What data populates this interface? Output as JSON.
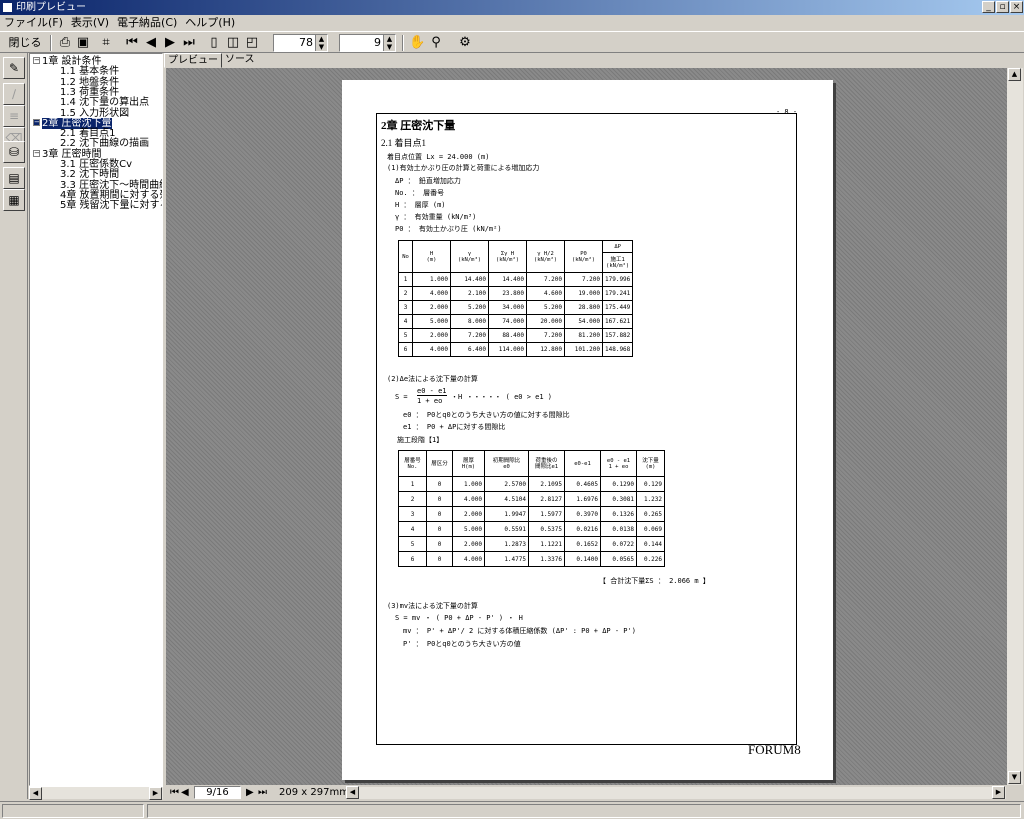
{
  "window": {
    "title": "印刷プレビュー"
  },
  "menu": [
    "ファイル(F)",
    "表示(V)",
    "電子納品(C)",
    "ヘルプ(H)"
  ],
  "toolbar": {
    "close_label": "閉じる",
    "zoom_value": "78",
    "page_value": "9"
  },
  "tree": [
    {
      "label": "1章 設計条件",
      "toggle": "−"
    },
    {
      "label": "1.1 基本条件"
    },
    {
      "label": "1.2 地盤条件"
    },
    {
      "label": "1.3 荷重条件"
    },
    {
      "label": "1.4 沈下量の算出点"
    },
    {
      "label": "1.5 入力形状図"
    },
    {
      "label": "2章 圧密沈下量",
      "toggle": "−",
      "selected": true
    },
    {
      "label": "2.1 着目点1"
    },
    {
      "label": "2.2 沈下曲線の描画"
    },
    {
      "label": "3章 圧密時間",
      "toggle": "−"
    },
    {
      "label": "3.1 圧密係数Cv"
    },
    {
      "label": "3.2 沈下時間"
    },
    {
      "label": "3.3 圧密沈下〜時間曲線"
    },
    {
      "label": "4章 放置期間に対する残留沈"
    },
    {
      "label": "5章 残留沈下量に対する放置"
    }
  ],
  "tabs": [
    "プレビュー",
    "ソース"
  ],
  "document": {
    "page_no": "- 8 -",
    "chapter": "2章 圧密沈下量",
    "section": "2.1 着目点1",
    "lx": "着目点位置 Lx =  24.000 (m)",
    "sub1": "(1)有効土かぶり圧の計算と荷重による増加応力",
    "defs": [
      "ΔP ： 鉛直増加応力",
      "No. ： 層番号",
      "H  ： 層厚 (m)",
      "γ  ： 有効重量 (kN/m³)",
      "P0 ： 有効土かぶり圧 (kN/m²)"
    ],
    "table1": {
      "headers": [
        "No",
        "H\n(m)",
        "γ\n(kN/m³)",
        "Σγ H\n(kN/m²)",
        "γ H/2\n(kN/m²)",
        "P0\n(kN/m²)",
        "ΔP",
        "施工1\n(kN/m²)"
      ],
      "rows": [
        [
          "1",
          "1.000",
          "14.400",
          "14.400",
          "7.200",
          "7.200",
          "179.996"
        ],
        [
          "2",
          "4.000",
          "2.100",
          "23.800",
          "4.600",
          "19.000",
          "179.241"
        ],
        [
          "3",
          "2.000",
          "5.200",
          "34.000",
          "5.200",
          "28.800",
          "175.449"
        ],
        [
          "4",
          "5.000",
          "8.000",
          "74.000",
          "20.000",
          "54.000",
          "167.621"
        ],
        [
          "5",
          "2.000",
          "7.200",
          "88.400",
          "7.200",
          "81.200",
          "157.882"
        ],
        [
          "6",
          "4.000",
          "6.400",
          "114.000",
          "12.800",
          "101.200",
          "148.968"
        ]
      ]
    },
    "sub2": "(2)Δe法による沈下量の計算",
    "formula_s": "S =",
    "formula_num": "e0 - e1",
    "formula_den": "1 + eo",
    "formula_tail": "・H     ・・・・・  ( e0 > e1 )",
    "e_defs": [
      "e0 ： P0とq0とのうち大きい方の値に対する間隙比",
      "e1 ： P0 + ΔPに対する間隙比"
    ],
    "stage": "施工段階【1】",
    "table2": {
      "headers": [
        "層番号\nNo.",
        "層区分",
        "層厚\nH(m)",
        "初期間隙比\ne0",
        "荷重後の\n間隙比e1",
        "e0-e1",
        "e0 - e1\n1 + eo",
        "沈下量\n(m)"
      ],
      "rows": [
        [
          "1",
          "0",
          "1.000",
          "2.5700",
          "2.1095",
          "0.4605",
          "0.1290",
          "0.129"
        ],
        [
          "2",
          "0",
          "4.000",
          "4.5104",
          "2.8127",
          "1.6976",
          "0.3081",
          "1.232"
        ],
        [
          "3",
          "0",
          "2.000",
          "1.9947",
          "1.5977",
          "0.3970",
          "0.1326",
          "0.265"
        ],
        [
          "4",
          "0",
          "5.000",
          "0.5591",
          "0.5375",
          "0.0216",
          "0.0138",
          "0.069"
        ],
        [
          "5",
          "0",
          "2.000",
          "1.2873",
          "1.1221",
          "0.1652",
          "0.0722",
          "0.144"
        ],
        [
          "6",
          "0",
          "4.000",
          "1.4775",
          "1.3376",
          "0.1400",
          "0.0565",
          "0.226"
        ]
      ]
    },
    "total": "【 合計沈下量ΣS ：    2.066 m 】",
    "sub3": "(3)mv法による沈下量の計算",
    "mv_formula": "S = mv ・ ( P0 + ΔP - P' ) ・ H",
    "mv_defs": [
      "mv ： P' + ΔP'/ 2 に対する体積圧縮係数 (ΔP' : P0 + ΔP - P')",
      "P'  ： P0とq0とのうち大きい方の値"
    ],
    "brand": "FORUM8"
  },
  "bottombar": {
    "page_indicator": "9/16",
    "page_size": "209 x 297mm"
  }
}
